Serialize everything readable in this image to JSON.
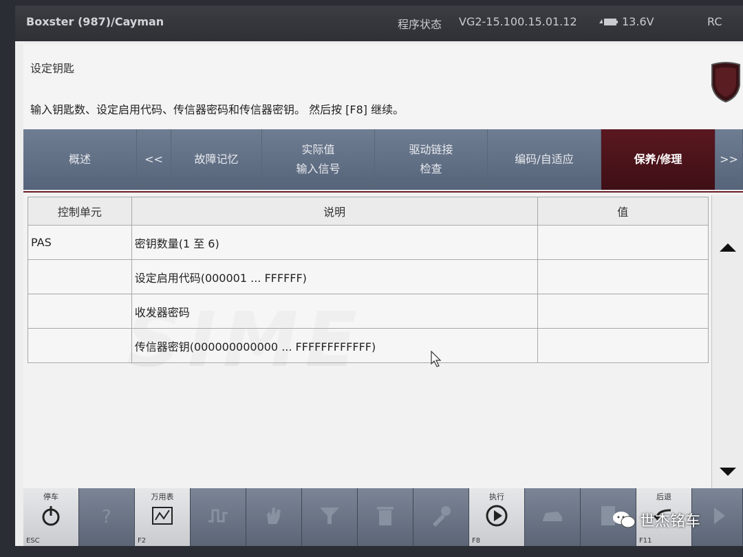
{
  "topbar": {
    "model": "Boxster (987)/Cayman",
    "status_label": "程序状态",
    "version": "VG2-15.100.15.01.12",
    "voltage": "13.6V",
    "rc": "RC"
  },
  "header": {
    "title": "设定钥匙",
    "instruction": "输入钥匙数、设定启用代码、传信器密码和传信器密钥。 然后按 [F8] 继续。"
  },
  "tabs": [
    {
      "label": "概述",
      "label2": ""
    },
    {
      "label": "<<",
      "label2": ""
    },
    {
      "label": "故障记忆",
      "label2": ""
    },
    {
      "label": "实际值",
      "label2": "输入信号"
    },
    {
      "label": "驱动链接",
      "label2": "检查"
    },
    {
      "label": "编码/自适应",
      "label2": ""
    },
    {
      "label": "保养/修理",
      "label2": ""
    },
    {
      "label": ">>",
      "label2": ""
    }
  ],
  "table": {
    "headers": [
      "控制单元",
      "说明",
      "值"
    ],
    "rows": [
      {
        "unit": "PAS",
        "desc": "密钥数量(1 至 6)",
        "value": ""
      },
      {
        "unit": "",
        "desc": "设定启用代码(000001 ... FFFFFF)",
        "value": ""
      },
      {
        "unit": "",
        "desc": "收发器密码",
        "value": ""
      },
      {
        "unit": "",
        "desc": "传信器密钥(000000000000 ... FFFFFFFFFFFF)",
        "value": ""
      }
    ]
  },
  "fkeys": [
    {
      "label": "停车",
      "num": "ESC",
      "icon": "power-icon",
      "enabled": true
    },
    {
      "label": "",
      "num": "",
      "icon": "help-icon",
      "enabled": false
    },
    {
      "label": "万用表",
      "num": "F2",
      "icon": "multimeter-icon",
      "enabled": true
    },
    {
      "label": "",
      "num": "",
      "icon": "oscilloscope-icon",
      "enabled": false
    },
    {
      "label": "",
      "num": "",
      "icon": "hand-icon",
      "enabled": false
    },
    {
      "label": "",
      "num": "",
      "icon": "filter-icon",
      "enabled": false
    },
    {
      "label": "",
      "num": "",
      "icon": "trash-icon",
      "enabled": false
    },
    {
      "label": "",
      "num": "",
      "icon": "tools-icon",
      "enabled": false
    },
    {
      "label": "执行",
      "num": "F8",
      "icon": "play-icon",
      "enabled": true
    },
    {
      "label": "",
      "num": "",
      "icon": "car-icon",
      "enabled": false
    },
    {
      "label": "",
      "num": "",
      "icon": "document-icon",
      "enabled": false
    },
    {
      "label": "后退",
      "num": "F11",
      "icon": "back-icon",
      "enabled": true
    },
    {
      "label": "",
      "num": "",
      "icon": "forward-icon",
      "enabled": false
    }
  ],
  "watermark": "SIME",
  "wechat": "世杰铭车"
}
